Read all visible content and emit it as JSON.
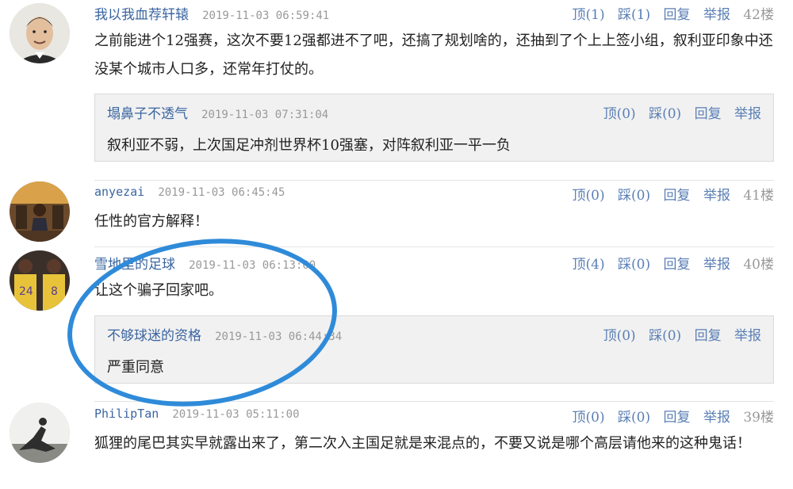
{
  "comments": [
    {
      "user": "我以我血荐轩辕",
      "time": "2019-11-03 06:59:41",
      "up": "顶(1)",
      "down": "踩(1)",
      "reply": "回复",
      "report": "举报",
      "floor": "42楼",
      "text": "之前能进个12强赛，这次不要12强都进不了吧，还搞了规划啥的，还抽到了个上上签小组，叙利亚印象中还没某个城市人口多，还常年打仗的。",
      "replies": [
        {
          "user": "塌鼻子不透气",
          "time": "2019-11-03 07:31:04",
          "up": "顶(0)",
          "down": "踩(0)",
          "reply": "回复",
          "report": "举报",
          "text": "叙利亚不弱，上次国足冲剂世界杯10强塞，对阵叙利亚一平一负"
        }
      ]
    },
    {
      "user": "anyezai",
      "time": "2019-11-03 06:45:45",
      "up": "顶(0)",
      "down": "踩(0)",
      "reply": "回复",
      "report": "举报",
      "floor": "41楼",
      "text": "任性的官方解释！"
    },
    {
      "user": "雪地里的足球",
      "time": "2019-11-03 06:13:00",
      "up": "顶(4)",
      "down": "踩(0)",
      "reply": "回复",
      "report": "举报",
      "floor": "40楼",
      "text": "让这个骗子回家吧。",
      "replies": [
        {
          "user": "不够球迷的资格",
          "time": "2019-11-03 06:44:34",
          "up": "顶(0)",
          "down": "踩(0)",
          "reply": "回复",
          "report": "举报",
          "text": "严重同意"
        }
      ]
    },
    {
      "user": "PhilipTan",
      "time": "2019-11-03 05:11:00",
      "up": "顶(0)",
      "down": "踩(0)",
      "reply": "回复",
      "report": "举报",
      "floor": "39楼",
      "text": "狐狸的尾巴其实早就露出来了，第二次入主国足就是来混点的，不要又说是哪个高层请他来的这种鬼话！"
    }
  ],
  "colors": {
    "link": "#3a65a0",
    "action": "#5a7fb5",
    "muted": "#999999",
    "annotation": "#2f8bd9"
  }
}
